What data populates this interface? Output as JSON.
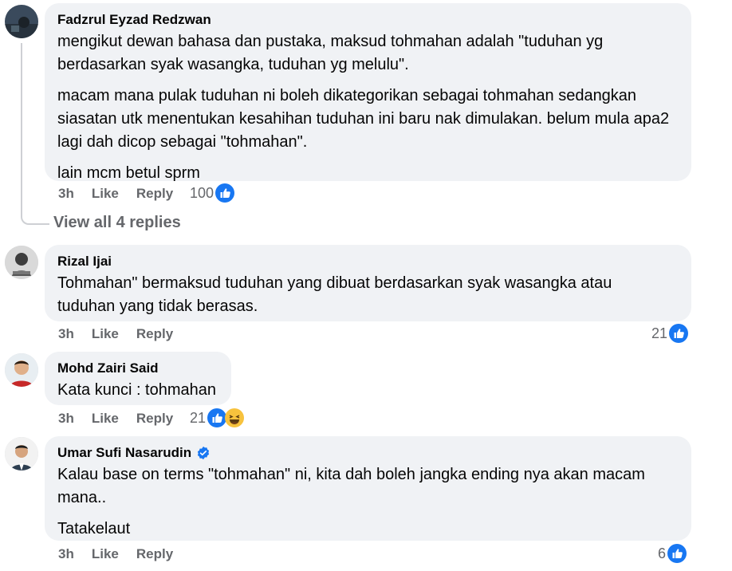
{
  "comments": [
    {
      "author": "Fadzrul Eyzad Redzwan",
      "paragraphs": [
        "mengikut dewan bahasa dan pustaka, maksud tohmahan adalah \"tuduhan yg berdasarkan syak wasangka, tuduhan yg melulu\".",
        "macam mana pulak tuduhan ni boleh dikategorikan sebagai tohmahan sedangkan siasatan utk menentukan kesahihan tuduhan ini baru nak dimulakan. belum mula apa2 lagi dah dicop sebagai \"tohmahan\".",
        "lain mcm betul sprm"
      ],
      "time": "3h",
      "like": "Like",
      "reply": "Reply",
      "reactions": "100"
    },
    {
      "author": "Rizal Ijai",
      "paragraphs": [
        "Tohmahan\" bermaksud tuduhan yang dibuat berdasarkan syak wasangka atau tuduhan yang tidak berasas."
      ],
      "time": "3h",
      "like": "Like",
      "reply": "Reply",
      "reactions": "21"
    },
    {
      "author": "Mohd Zairi Said",
      "paragraphs": [
        "Kata kunci : tohmahan"
      ],
      "time": "3h",
      "like": "Like",
      "reply": "Reply",
      "reactions": "21"
    },
    {
      "author": "Umar Sufi Nasarudin",
      "verified": true,
      "paragraphs": [
        "Kalau base on terms \"tohmahan\" ni, kita dah boleh jangka ending nya akan macam mana..",
        "Tatakelaut"
      ],
      "time": "3h",
      "like": "Like",
      "reply": "Reply",
      "reactions": "6"
    }
  ],
  "view_replies": "View all 4 replies",
  "colors": {
    "like_blue": "#1877f2",
    "bubble": "#f0f2f5",
    "meta": "#65676b",
    "verified": "#1877f2"
  },
  "icons": {
    "like": "thumbs-up-icon",
    "haha": "laughing-emoji-icon",
    "verified": "verified-badge-icon"
  }
}
